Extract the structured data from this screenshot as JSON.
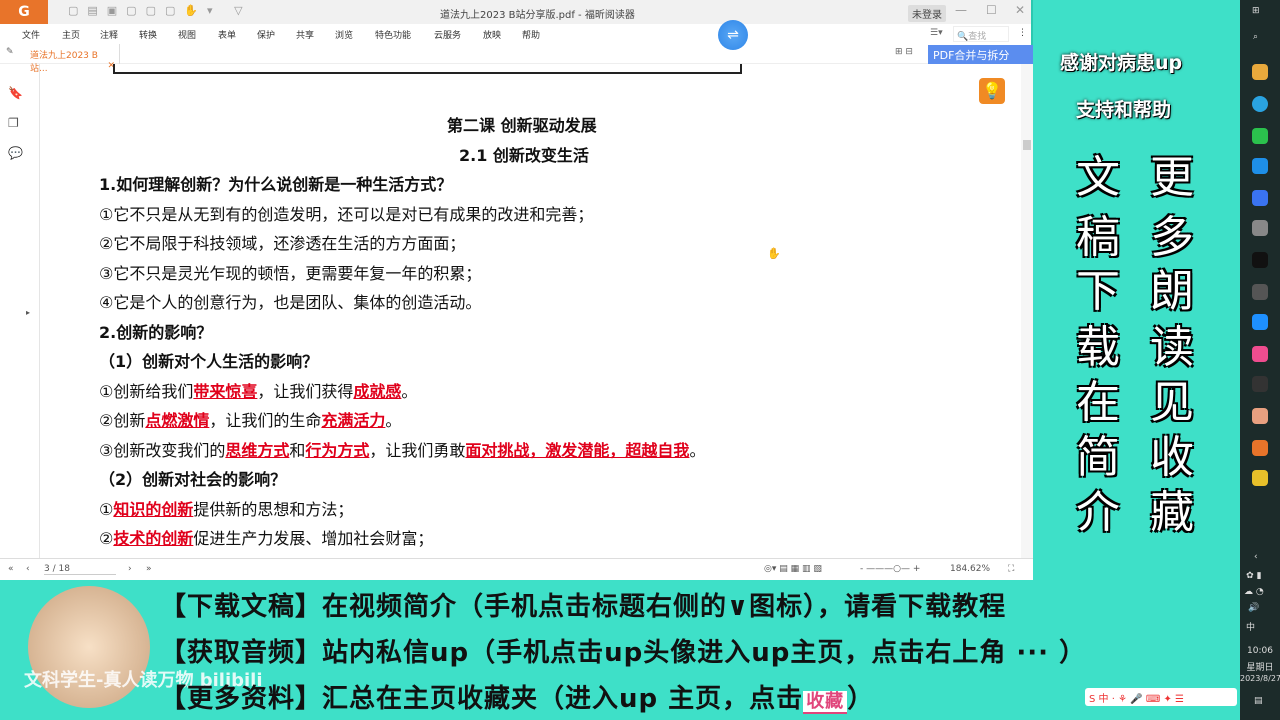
{
  "app": {
    "title": "道法九上2023 B站分享版.pdf - 福昕阅读器",
    "login": "未登录",
    "tab": "道法九上2023 B站...",
    "search_placeholder": "查找",
    "merge_btn": "PDF合并与拆分"
  },
  "menu": [
    "文件",
    "主页",
    "注释",
    "转换",
    "视图",
    "表单",
    "保护",
    "共享",
    "浏览",
    "特色功能",
    "云服务",
    "放映",
    "帮助"
  ],
  "doc": {
    "lesson": "第二课  创新驱动发展",
    "section": "2.1  创新改变生活",
    "q1": "1.如何理解创新？为什么说创新是一种生活方式？",
    "a1": "①它不只是从无到有的创造发明，还可以是对已有成果的改进和完善；",
    "a2": "②它不局限于科技领域，还渗透在生活的方方面面；",
    "a3": "③它不只是灵光乍现的顿悟，更需要年复一年的积累；",
    "a4": "④它是个人的创意行为，也是团队、集体的创造活动。",
    "q2": "2.创新的影响？",
    "q2a": "（1）创新对个人生活的影响？",
    "l1": [
      "①创新给我们",
      "带来惊喜",
      "，让我们获得",
      "成就感",
      "。"
    ],
    "l2": [
      "②创新",
      "点燃激情",
      "，让我们的生命",
      "充满活力",
      "。"
    ],
    "l3": [
      "③创新改变我们的",
      "思维方式",
      "和",
      "行为方式",
      "，让我们勇敢",
      "面对挑战，激发潜能，超越自我",
      "。"
    ],
    "q2b": "（2）创新对社会的影响？",
    "l4": [
      "①",
      "知识的创新",
      "提供新的思想和方法；"
    ],
    "l5": [
      "②",
      "技术的创新",
      "促进生产力发展、增加社会财富；"
    ]
  },
  "status": {
    "page": "3 / 18",
    "zoom": "184.62%"
  },
  "overlay": {
    "thanks1": "感谢对病患up",
    "thanks2": "支持和帮助",
    "col1": [
      "更",
      "多",
      "朗",
      "读",
      "见",
      "收",
      "藏"
    ],
    "col2": [
      "文",
      "稿",
      "下",
      "载",
      "在",
      "简",
      "介"
    ],
    "line1": "【下载文稿】在视频简介（手机点击标题右侧的∨图标），请看下载教程",
    "line2": "【获取音频】站内私信up（手机点击up头像进入up主页，点击右上角 ··· ）",
    "line3": "【更多资料】汇总在主页收藏夹（进入up 主页，点击",
    "line3_btn": "收藏",
    "line3_end": "）",
    "watermark": "文科学生-真人读万物 bilibili"
  },
  "taskbar": {
    "time": "10:06",
    "day": "星期日",
    "date": "2023/8/27",
    "ime": "中"
  }
}
